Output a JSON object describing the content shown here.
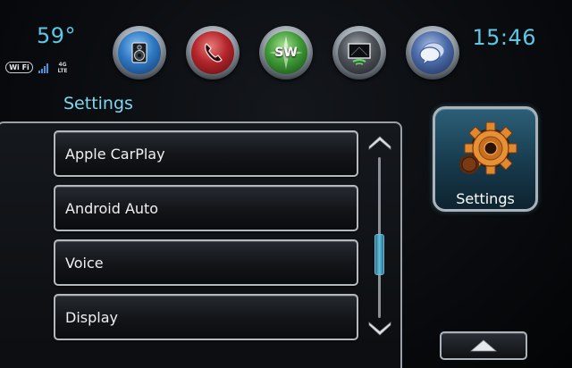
{
  "status": {
    "temperature": "59°",
    "time": "15:46",
    "wifi_label": "Wi Fi",
    "network_label": "4G LTE"
  },
  "apps": [
    {
      "name": "audio",
      "icon": "speaker-icon"
    },
    {
      "name": "phone",
      "icon": "phone-handset-icon"
    },
    {
      "name": "navigation",
      "icon": "compass-icon",
      "label": "SW"
    },
    {
      "name": "projection",
      "icon": "screen-icon"
    },
    {
      "name": "messages",
      "icon": "chat-bubble-icon"
    }
  ],
  "section_title": "Settings",
  "settings_list": {
    "items": [
      {
        "label": "Apple CarPlay"
      },
      {
        "label": "Android Auto"
      },
      {
        "label": "Voice"
      },
      {
        "label": "Display"
      }
    ]
  },
  "settings_tile": {
    "label": "Settings",
    "icon": "gear-icon"
  },
  "colors": {
    "accent": "#5cc7e6",
    "title": "#7fd8ee",
    "tile": "#2c5f78"
  }
}
